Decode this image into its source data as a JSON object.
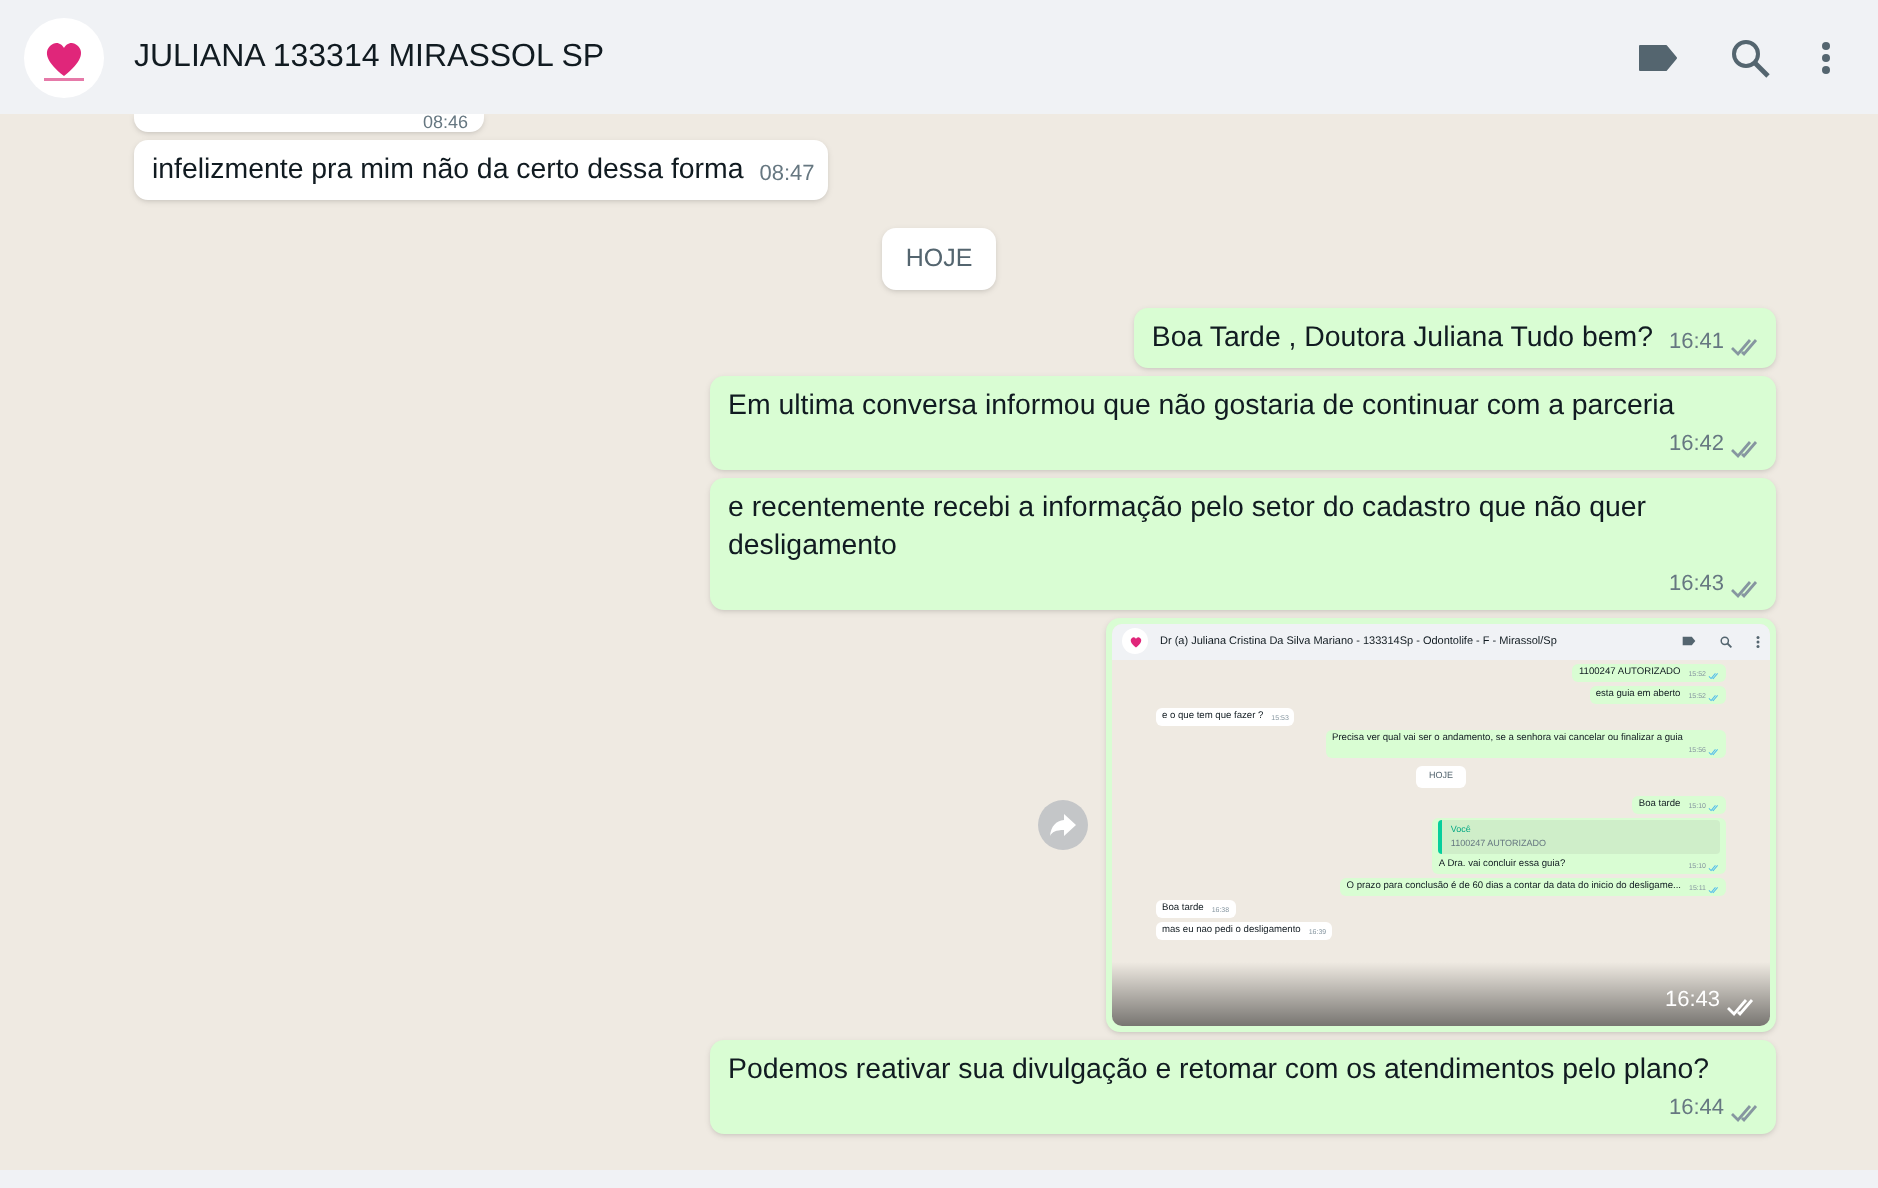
{
  "header": {
    "title": "JULIANA 133314 MIRASSOL SP"
  },
  "messages": [
    {
      "kind": "text",
      "outgoing": false,
      "cut": true,
      "time": "08:46"
    },
    {
      "kind": "text",
      "outgoing": false,
      "text": "infelizmente pra mim não da certo dessa forma",
      "time": "08:47"
    },
    {
      "kind": "date",
      "text": "HOJE"
    },
    {
      "kind": "text",
      "outgoing": true,
      "text": "Boa Tarde , Doutora Juliana Tudo bem?",
      "time": "16:41",
      "read": false
    },
    {
      "kind": "text",
      "outgoing": true,
      "text": "Em ultima conversa informou que não gostaria de continuar com a parceria",
      "time": "16:42",
      "read": false
    },
    {
      "kind": "text",
      "outgoing": true,
      "text": "e recentemente recebi a informação pelo setor do cadastro que não quer desligamento",
      "time": "16:43",
      "read": false
    },
    {
      "kind": "image",
      "outgoing": true,
      "time": "16:43",
      "read": false,
      "screenshot": {
        "title": "Dr (a) Juliana Cristina Da Silva Mariano - 133314Sp - Odontolife - F - Mirassol/Sp",
        "messages": [
          {
            "kind": "text",
            "outgoing": true,
            "text": "1100247 AUTORIZADO",
            "time": "15:52"
          },
          {
            "kind": "text",
            "outgoing": true,
            "text": "esta guia em aberto",
            "time": "15:52"
          },
          {
            "kind": "text",
            "outgoing": false,
            "text": "e o que tem que fazer ?",
            "time": "15:53"
          },
          {
            "kind": "text",
            "outgoing": true,
            "text": "Precisa ver qual vai ser o andamento, se a senhora vai cancelar ou finalizar a guia",
            "time": "15:56"
          },
          {
            "kind": "date",
            "text": "HOJE"
          },
          {
            "kind": "text",
            "outgoing": true,
            "text": "Boa tarde",
            "time": "15:10"
          },
          {
            "kind": "reply",
            "outgoing": true,
            "quote_author": "Você",
            "quote_text": "1100247 AUTORIZADO",
            "text": "A Dra. vai concluir essa guia?",
            "time": "15:10"
          },
          {
            "kind": "text",
            "outgoing": true,
            "text": "O prazo para conclusão é de 60 dias a contar da data do inicio do desligame...",
            "time": "15:11"
          },
          {
            "kind": "text",
            "outgoing": false,
            "text": "Boa tarde",
            "time": "16:38"
          },
          {
            "kind": "text",
            "outgoing": false,
            "text": "mas eu nao pedi o desligamento",
            "time": "16:39"
          }
        ]
      }
    },
    {
      "kind": "text",
      "outgoing": true,
      "text": "Podemos reativar sua divulgação e retomar com os atendimentos pelo plano?",
      "time": "16:44",
      "read": false
    }
  ]
}
